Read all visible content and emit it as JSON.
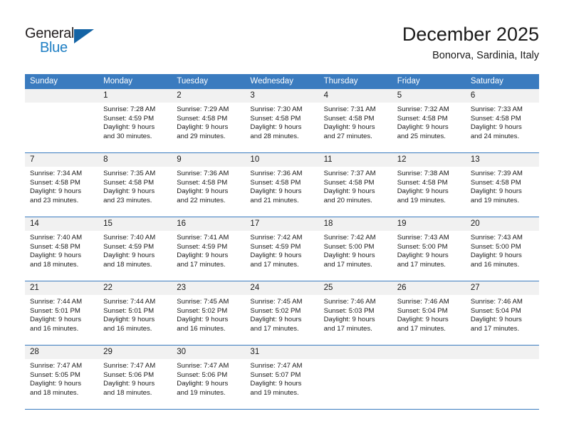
{
  "brand": {
    "word_general": "General",
    "word_blue": "Blue",
    "triangle_color": "#1464a5",
    "blue_text_color": "#1f7fc4"
  },
  "header": {
    "title": "December 2025",
    "location": "Bonorva, Sardinia, Italy",
    "accent_color": "#3a7bbf",
    "day_band_color": "#f1f1f1"
  },
  "weekdays": [
    "Sunday",
    "Monday",
    "Tuesday",
    "Wednesday",
    "Thursday",
    "Friday",
    "Saturday"
  ],
  "weeks": [
    [
      {
        "num": "",
        "sunrise": "",
        "sunset": "",
        "daylight1": "",
        "daylight2": ""
      },
      {
        "num": "1",
        "sunrise": "Sunrise: 7:28 AM",
        "sunset": "Sunset: 4:59 PM",
        "daylight1": "Daylight: 9 hours",
        "daylight2": "and 30 minutes."
      },
      {
        "num": "2",
        "sunrise": "Sunrise: 7:29 AM",
        "sunset": "Sunset: 4:58 PM",
        "daylight1": "Daylight: 9 hours",
        "daylight2": "and 29 minutes."
      },
      {
        "num": "3",
        "sunrise": "Sunrise: 7:30 AM",
        "sunset": "Sunset: 4:58 PM",
        "daylight1": "Daylight: 9 hours",
        "daylight2": "and 28 minutes."
      },
      {
        "num": "4",
        "sunrise": "Sunrise: 7:31 AM",
        "sunset": "Sunset: 4:58 PM",
        "daylight1": "Daylight: 9 hours",
        "daylight2": "and 27 minutes."
      },
      {
        "num": "5",
        "sunrise": "Sunrise: 7:32 AM",
        "sunset": "Sunset: 4:58 PM",
        "daylight1": "Daylight: 9 hours",
        "daylight2": "and 25 minutes."
      },
      {
        "num": "6",
        "sunrise": "Sunrise: 7:33 AM",
        "sunset": "Sunset: 4:58 PM",
        "daylight1": "Daylight: 9 hours",
        "daylight2": "and 24 minutes."
      }
    ],
    [
      {
        "num": "7",
        "sunrise": "Sunrise: 7:34 AM",
        "sunset": "Sunset: 4:58 PM",
        "daylight1": "Daylight: 9 hours",
        "daylight2": "and 23 minutes."
      },
      {
        "num": "8",
        "sunrise": "Sunrise: 7:35 AM",
        "sunset": "Sunset: 4:58 PM",
        "daylight1": "Daylight: 9 hours",
        "daylight2": "and 23 minutes."
      },
      {
        "num": "9",
        "sunrise": "Sunrise: 7:36 AM",
        "sunset": "Sunset: 4:58 PM",
        "daylight1": "Daylight: 9 hours",
        "daylight2": "and 22 minutes."
      },
      {
        "num": "10",
        "sunrise": "Sunrise: 7:36 AM",
        "sunset": "Sunset: 4:58 PM",
        "daylight1": "Daylight: 9 hours",
        "daylight2": "and 21 minutes."
      },
      {
        "num": "11",
        "sunrise": "Sunrise: 7:37 AM",
        "sunset": "Sunset: 4:58 PM",
        "daylight1": "Daylight: 9 hours",
        "daylight2": "and 20 minutes."
      },
      {
        "num": "12",
        "sunrise": "Sunrise: 7:38 AM",
        "sunset": "Sunset: 4:58 PM",
        "daylight1": "Daylight: 9 hours",
        "daylight2": "and 19 minutes."
      },
      {
        "num": "13",
        "sunrise": "Sunrise: 7:39 AM",
        "sunset": "Sunset: 4:58 PM",
        "daylight1": "Daylight: 9 hours",
        "daylight2": "and 19 minutes."
      }
    ],
    [
      {
        "num": "14",
        "sunrise": "Sunrise: 7:40 AM",
        "sunset": "Sunset: 4:58 PM",
        "daylight1": "Daylight: 9 hours",
        "daylight2": "and 18 minutes."
      },
      {
        "num": "15",
        "sunrise": "Sunrise: 7:40 AM",
        "sunset": "Sunset: 4:59 PM",
        "daylight1": "Daylight: 9 hours",
        "daylight2": "and 18 minutes."
      },
      {
        "num": "16",
        "sunrise": "Sunrise: 7:41 AM",
        "sunset": "Sunset: 4:59 PM",
        "daylight1": "Daylight: 9 hours",
        "daylight2": "and 17 minutes."
      },
      {
        "num": "17",
        "sunrise": "Sunrise: 7:42 AM",
        "sunset": "Sunset: 4:59 PM",
        "daylight1": "Daylight: 9 hours",
        "daylight2": "and 17 minutes."
      },
      {
        "num": "18",
        "sunrise": "Sunrise: 7:42 AM",
        "sunset": "Sunset: 5:00 PM",
        "daylight1": "Daylight: 9 hours",
        "daylight2": "and 17 minutes."
      },
      {
        "num": "19",
        "sunrise": "Sunrise: 7:43 AM",
        "sunset": "Sunset: 5:00 PM",
        "daylight1": "Daylight: 9 hours",
        "daylight2": "and 17 minutes."
      },
      {
        "num": "20",
        "sunrise": "Sunrise: 7:43 AM",
        "sunset": "Sunset: 5:00 PM",
        "daylight1": "Daylight: 9 hours",
        "daylight2": "and 16 minutes."
      }
    ],
    [
      {
        "num": "21",
        "sunrise": "Sunrise: 7:44 AM",
        "sunset": "Sunset: 5:01 PM",
        "daylight1": "Daylight: 9 hours",
        "daylight2": "and 16 minutes."
      },
      {
        "num": "22",
        "sunrise": "Sunrise: 7:44 AM",
        "sunset": "Sunset: 5:01 PM",
        "daylight1": "Daylight: 9 hours",
        "daylight2": "and 16 minutes."
      },
      {
        "num": "23",
        "sunrise": "Sunrise: 7:45 AM",
        "sunset": "Sunset: 5:02 PM",
        "daylight1": "Daylight: 9 hours",
        "daylight2": "and 16 minutes."
      },
      {
        "num": "24",
        "sunrise": "Sunrise: 7:45 AM",
        "sunset": "Sunset: 5:02 PM",
        "daylight1": "Daylight: 9 hours",
        "daylight2": "and 17 minutes."
      },
      {
        "num": "25",
        "sunrise": "Sunrise: 7:46 AM",
        "sunset": "Sunset: 5:03 PM",
        "daylight1": "Daylight: 9 hours",
        "daylight2": "and 17 minutes."
      },
      {
        "num": "26",
        "sunrise": "Sunrise: 7:46 AM",
        "sunset": "Sunset: 5:04 PM",
        "daylight1": "Daylight: 9 hours",
        "daylight2": "and 17 minutes."
      },
      {
        "num": "27",
        "sunrise": "Sunrise: 7:46 AM",
        "sunset": "Sunset: 5:04 PM",
        "daylight1": "Daylight: 9 hours",
        "daylight2": "and 17 minutes."
      }
    ],
    [
      {
        "num": "28",
        "sunrise": "Sunrise: 7:47 AM",
        "sunset": "Sunset: 5:05 PM",
        "daylight1": "Daylight: 9 hours",
        "daylight2": "and 18 minutes."
      },
      {
        "num": "29",
        "sunrise": "Sunrise: 7:47 AM",
        "sunset": "Sunset: 5:06 PM",
        "daylight1": "Daylight: 9 hours",
        "daylight2": "and 18 minutes."
      },
      {
        "num": "30",
        "sunrise": "Sunrise: 7:47 AM",
        "sunset": "Sunset: 5:06 PM",
        "daylight1": "Daylight: 9 hours",
        "daylight2": "and 19 minutes."
      },
      {
        "num": "31",
        "sunrise": "Sunrise: 7:47 AM",
        "sunset": "Sunset: 5:07 PM",
        "daylight1": "Daylight: 9 hours",
        "daylight2": "and 19 minutes."
      },
      {
        "num": "",
        "sunrise": "",
        "sunset": "",
        "daylight1": "",
        "daylight2": ""
      },
      {
        "num": "",
        "sunrise": "",
        "sunset": "",
        "daylight1": "",
        "daylight2": ""
      },
      {
        "num": "",
        "sunrise": "",
        "sunset": "",
        "daylight1": "",
        "daylight2": ""
      }
    ]
  ]
}
